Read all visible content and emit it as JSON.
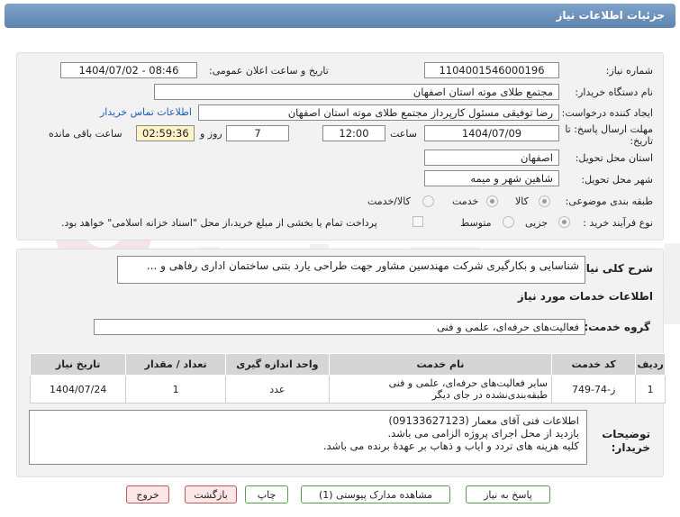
{
  "header": {
    "title": "جزئیات اطلاعات نیاز"
  },
  "form": {
    "need_number_label": "شماره نیاز:",
    "need_number": "1104001546000196",
    "announce_label": "تاریخ و ساعت اعلان عمومی:",
    "announce_value": "1404/07/02 - 08:46",
    "buyer_label": "نام دستگاه خریدار:",
    "buyer_value": "مجتمع طلای موته استان اصفهان",
    "creator_label": "ایجاد کننده درخواست:",
    "creator_value": "رضا توفیقی مسئول کارپرداز مجتمع طلای موته استان اصفهان",
    "contact_link": "اطلاعات تماس خریدار",
    "deadline_label_1": "مهلت ارسال پاسخ: تا",
    "deadline_label_2": "تاریخ:",
    "deadline_date": "1404/07/09",
    "time_label": "ساعت",
    "deadline_time": "12:00",
    "days_value": "7",
    "days_label": "روز و",
    "remaining_time": "02:59:36",
    "remaining_label": "ساعت باقی مانده",
    "province_label": "استان محل تحویل:",
    "province_value": "اصفهان",
    "city_label": "شهر محل تحویل:",
    "city_value": "شاهین شهر و میمه",
    "category_label": "طبقه بندی موضوعی:",
    "category_options": [
      "کالا",
      "خدمت",
      "کالا/خدمت"
    ],
    "process_label": "نوع فرآیند خرید :",
    "process_options": [
      "جزیی",
      "متوسط"
    ],
    "payment_note": "پرداخت تمام یا بخشی از مبلغ خرید،از محل \"اسناد خزانه اسلامی\" خواهد بود."
  },
  "description": {
    "label": "شرح کلی نیاز:",
    "value": "شناسایی و بکارگیری شرکت مهندسین مشاور جهت طراحی یارد بتنی ساختمان اداری رفاهی و ..."
  },
  "services": {
    "section_title": "اطلاعات خدمات مورد نیاز",
    "group_label": "گروه خدمت:",
    "group_value": "فعالیت‌های حرفه‌ای، علمی و فنی",
    "columns": [
      "ردیف",
      "کد خدمت",
      "نام خدمت",
      "واحد اندازه گیری",
      "تعداد / مقدار",
      "تاریخ نیاز"
    ],
    "rows": [
      [
        "1",
        "ز-74-749",
        "سایر فعالیت‌های حرفه‌ای، علمی و فنی طبقه‌بندی‌نشده در جای دیگر",
        "عدد",
        "1",
        "1404/07/24"
      ]
    ]
  },
  "notes": {
    "label_1": "توضیحات",
    "label_2": "خریدار:",
    "lines": [
      "اطلاعات فنی آقای معمار (09133627123)",
      "بازدید از محل اجرای پروژه الزامی می باشد.",
      "کلیه هزینه های تردد و ایاب و ذهاب بر عهدۀ برنده می باشد."
    ]
  },
  "buttons": {
    "reply": "پاسخ به نیاز",
    "attachments": "مشاهده مدارک پیوستی (1)",
    "print": "چاپ",
    "back": "بازگشت",
    "exit": "خروج"
  },
  "colors": {
    "header": "#6e93bd",
    "panel": "#f2f2f2",
    "link": "#1a5fb4",
    "highlight": "#fdf3c6"
  }
}
